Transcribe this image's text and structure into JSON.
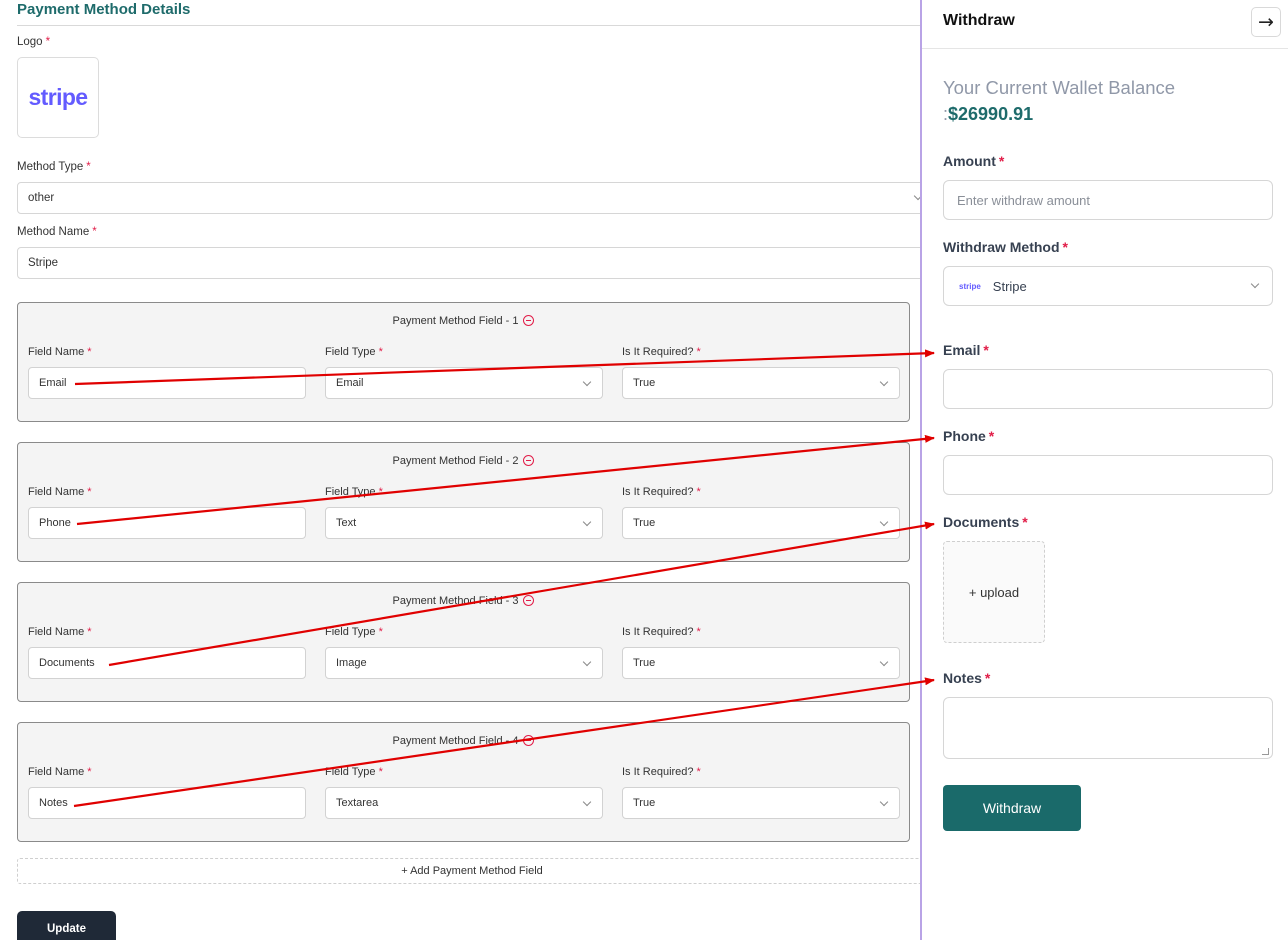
{
  "form": {
    "title": "Payment Method Details",
    "logo_label": "Logo",
    "logo_text": "stripe",
    "method_type_label": "Method Type",
    "method_type_value": "other",
    "method_name_label": "Method Name",
    "method_name_value": "Stripe",
    "required_mark": "*",
    "field_name_label": "Field Name",
    "field_type_label": "Field Type",
    "required_label": "Is It Required?",
    "fields": [
      {
        "title": "Payment Method Field - 1",
        "name": "Email",
        "type": "Email",
        "required": "True"
      },
      {
        "title": "Payment Method Field - 2",
        "name": "Phone",
        "type": "Text",
        "required": "True"
      },
      {
        "title": "Payment Method Field - 3",
        "name": "Documents",
        "type": "Image",
        "required": "True"
      },
      {
        "title": "Payment Method Field - 4",
        "name": "Notes",
        "type": "Textarea",
        "required": "True"
      }
    ],
    "add_field_label": "+ Add Payment Method Field",
    "update_label": "Update"
  },
  "panel": {
    "title": "Withdraw",
    "close_icon": "arrow-right-icon",
    "balance_label": "Your Current Wallet Balance",
    "balance_colon": ":",
    "balance_value": "$26990.91",
    "amount_label": "Amount",
    "amount_placeholder": "Enter withdraw amount",
    "method_label": "Withdraw Method",
    "method_logo": "stripe",
    "method_value": "Stripe",
    "email_label": "Email",
    "phone_label": "Phone",
    "documents_label": "Documents",
    "upload_label": "+ upload",
    "notes_label": "Notes",
    "submit_label": "Withdraw",
    "required_mark": "*"
  },
  "colors": {
    "accent": "#1e6b6b",
    "button_primary": "#1a6a6a",
    "button_dark": "#1f2937",
    "required": "#e11d48",
    "stripe_brand": "#635bff",
    "annotation_arrow": "#e00000",
    "panel_border": "#b9a3e6"
  }
}
